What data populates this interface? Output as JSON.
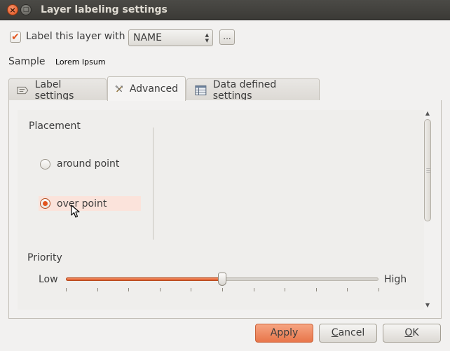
{
  "window": {
    "title": "Layer labeling settings",
    "close_glyph": "×",
    "maximize_glyph": "□"
  },
  "label_row": {
    "checkbox_label": "Label this layer with",
    "checked": true,
    "field_value": "NAME",
    "expression_button": "..."
  },
  "sample": {
    "label": "Sample",
    "value": "Lorem Ipsum"
  },
  "tabs": [
    {
      "label": "Label settings",
      "icon": "label-settings-icon"
    },
    {
      "label": "Advanced",
      "icon": "tools-icon",
      "active": true
    },
    {
      "label": "Data defined settings",
      "icon": "table-icon"
    }
  ],
  "advanced": {
    "placement": {
      "title": "Placement",
      "options": [
        "around point",
        "over point"
      ],
      "selected": "over point"
    },
    "priority": {
      "title": "Priority",
      "low_label": "Low",
      "high_label": "High",
      "value": 0.5
    }
  },
  "buttons": {
    "apply": "Apply",
    "cancel": {
      "mnemonic": "C",
      "rest": "ancel"
    },
    "ok": {
      "mnemonic": "O",
      "rest": "K"
    }
  },
  "colors": {
    "accent": "#e2541e",
    "highlight": "#fbe3db",
    "titlebar": "#3c3b37"
  }
}
